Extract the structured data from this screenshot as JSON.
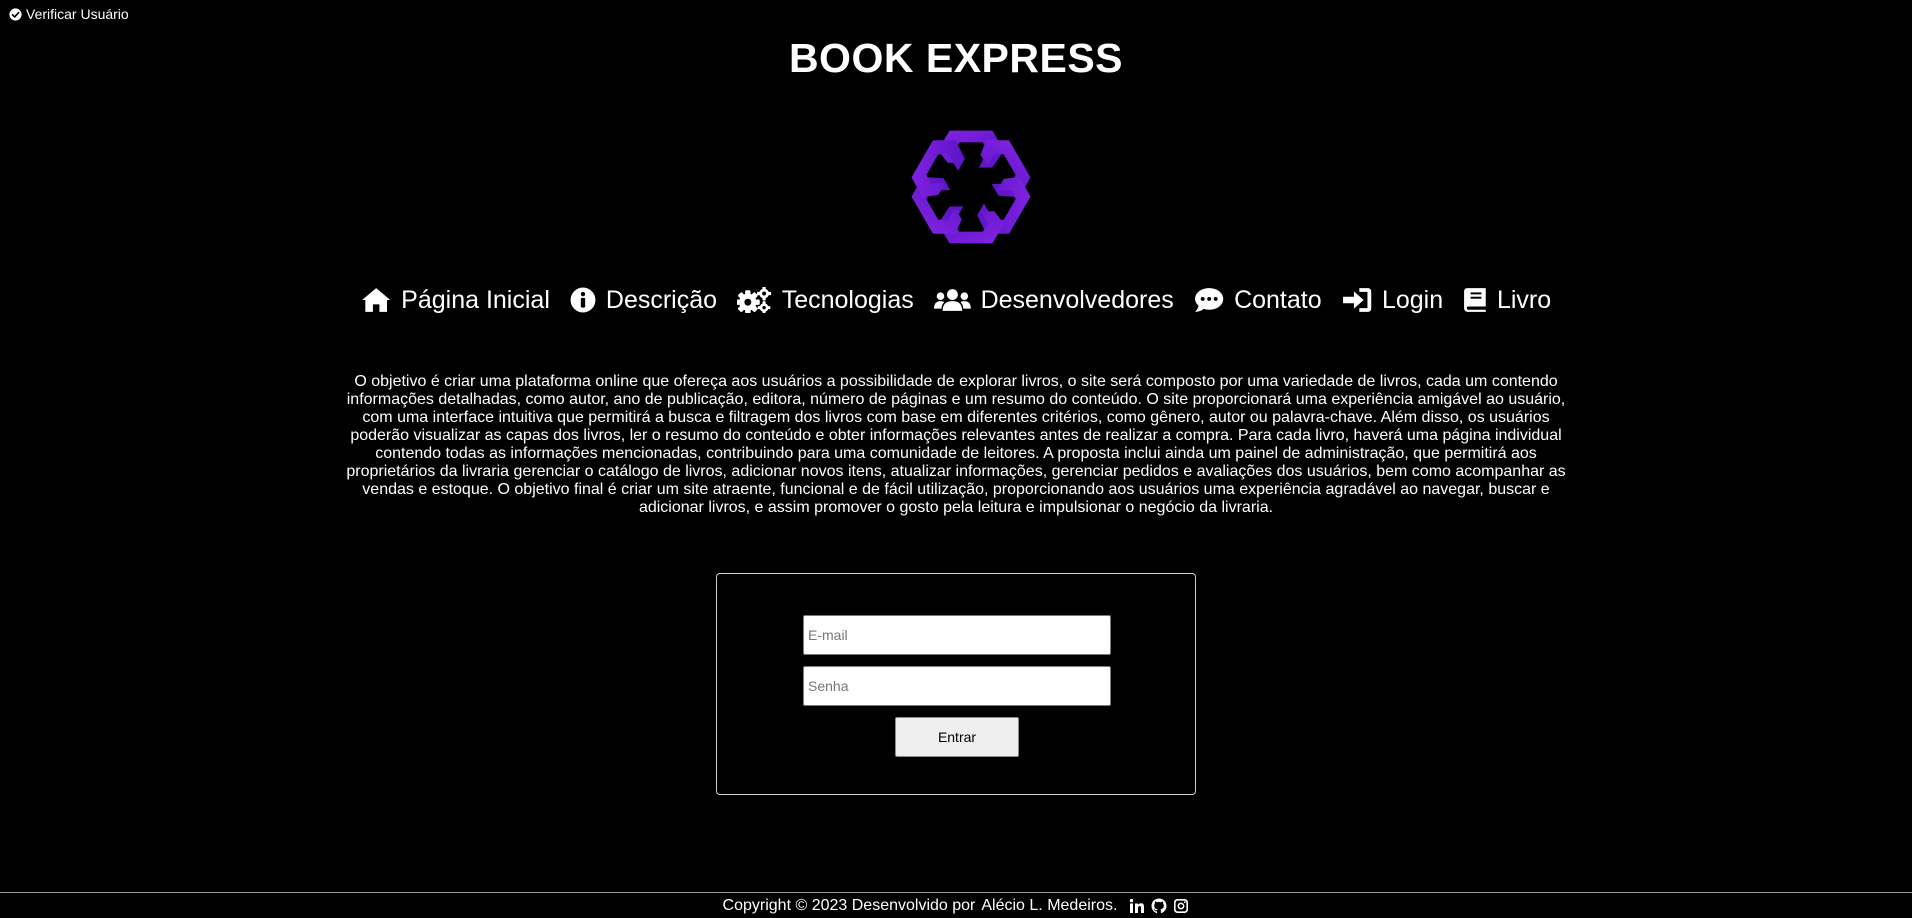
{
  "verify": {
    "label": "Verificar Usuário"
  },
  "header": {
    "title": "BOOK EXPRESS"
  },
  "logo": {
    "icon": "hexagonal-chain-logo-icon",
    "color": "#6f1bd0"
  },
  "nav": {
    "items": [
      {
        "label": "Página Inicial",
        "icon": "home-icon"
      },
      {
        "label": "Descrição",
        "icon": "info-icon"
      },
      {
        "label": "Tecnologias",
        "icon": "gears-icon"
      },
      {
        "label": "Desenvolvedores",
        "icon": "users-icon"
      },
      {
        "label": "Contato",
        "icon": "chat-icon"
      },
      {
        "label": "Login",
        "icon": "sign-in-icon"
      },
      {
        "label": "Livro",
        "icon": "book-icon"
      }
    ]
  },
  "description": {
    "text": "O objetivo é criar uma plataforma online que ofereça aos usuários a possibilidade de explorar livros, o site será composto por uma variedade de livros, cada um contendo informações detalhadas, como autor, ano de publicação, editora, número de páginas e um resumo do conteúdo. O site proporcionará uma experiência amigável ao usuário, com uma interface intuitiva que permitirá a busca e filtragem dos livros com base em diferentes critérios, como gênero, autor ou palavra-chave. Além disso, os usuários poderão visualizar as capas dos livros, ler o resumo do conteúdo e obter informações relevantes antes de realizar a compra. Para cada livro, haverá uma página individual contendo todas as informações mencionadas, contribuindo para uma comunidade de leitores. A proposta inclui ainda um painel de administração, que permitirá aos proprietários da livraria gerenciar o catálogo de livros, adicionar novos itens, atualizar informações, gerenciar pedidos e avaliações dos usuários, bem como acompanhar as vendas e estoque. O objetivo final é criar um site atraente, funcional e de fácil utilização, proporcionando aos usuários uma experiência agradável ao navegar, buscar e adicionar livros, e assim promover o gosto pela leitura e impulsionar o negócio da livraria."
  },
  "login": {
    "email_value": "",
    "email_placeholder": "E-mail",
    "password_value": "",
    "password_placeholder": "Senha",
    "submit_label": "Entrar"
  },
  "footer": {
    "copyright": "Copyright © 2023 Desenvolvido por",
    "author": "Alécio L. Medeiros.",
    "social": [
      "linkedin-icon",
      "github-icon",
      "instagram-icon"
    ]
  }
}
